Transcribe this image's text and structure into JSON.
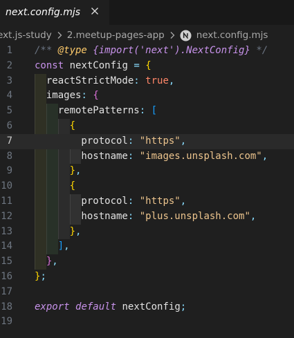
{
  "tab": {
    "filename": "next.config.mjs",
    "close_icon": "close-icon"
  },
  "breadcrumb": {
    "items": [
      "ext.js-study",
      "2.meetup-pages-app",
      "next.config.mjs"
    ],
    "file_icon": "nextjs-logo-icon",
    "separator_icon": "chevron-right-icon"
  },
  "editor": {
    "active_line": 7,
    "lines": [
      {
        "n": "1",
        "tokens": [
          {
            "t": "/** ",
            "c": "t-cmt"
          },
          {
            "t": "@type",
            "c": "t-tag"
          },
          {
            "t": " {import('next').NextConfig}",
            "c": "t-type"
          },
          {
            "t": " */",
            "c": "t-cmt"
          }
        ]
      },
      {
        "n": "2",
        "tokens": [
          {
            "t": "const",
            "c": "t-kw"
          },
          {
            "t": " nextConfig ",
            "c": "t-var"
          },
          {
            "t": "=",
            "c": "t-punc"
          },
          {
            "t": " ",
            "c": "t-var"
          },
          {
            "t": "{",
            "c": "b1"
          }
        ]
      },
      {
        "n": "3",
        "tokens": [
          {
            "t": "  reactStrictMode",
            "c": "t-prop"
          },
          {
            "t": ":",
            "c": "t-punc"
          },
          {
            "t": " ",
            "c": "t-var"
          },
          {
            "t": "true",
            "c": "t-bool"
          },
          {
            "t": ",",
            "c": "t-punc"
          }
        ]
      },
      {
        "n": "4",
        "tokens": [
          {
            "t": "  images",
            "c": "t-prop"
          },
          {
            "t": ":",
            "c": "t-punc"
          },
          {
            "t": " ",
            "c": "t-var"
          },
          {
            "t": "{",
            "c": "b2"
          }
        ]
      },
      {
        "n": "5",
        "tokens": [
          {
            "t": "    remotePatterns",
            "c": "t-prop"
          },
          {
            "t": ":",
            "c": "t-punc"
          },
          {
            "t": " ",
            "c": "t-var"
          },
          {
            "t": "[",
            "c": "b3"
          }
        ]
      },
      {
        "n": "6",
        "tokens": [
          {
            "t": "      ",
            "c": "t-var"
          },
          {
            "t": "{",
            "c": "b1"
          }
        ]
      },
      {
        "n": "7",
        "tokens": [
          {
            "t": "        protocol",
            "c": "t-prop"
          },
          {
            "t": ":",
            "c": "t-punc"
          },
          {
            "t": " ",
            "c": "t-var"
          },
          {
            "t": "\"https\"",
            "c": "t-str"
          },
          {
            "t": ",",
            "c": "t-punc"
          }
        ]
      },
      {
        "n": "8",
        "tokens": [
          {
            "t": "        hostname",
            "c": "t-prop"
          },
          {
            "t": ":",
            "c": "t-punc"
          },
          {
            "t": " ",
            "c": "t-var"
          },
          {
            "t": "\"images.unsplash.com\"",
            "c": "t-str"
          },
          {
            "t": ",",
            "c": "t-punc"
          }
        ]
      },
      {
        "n": "9",
        "tokens": [
          {
            "t": "      ",
            "c": "t-var"
          },
          {
            "t": "}",
            "c": "b1"
          },
          {
            "t": ",",
            "c": "t-punc"
          }
        ]
      },
      {
        "n": "10",
        "tokens": [
          {
            "t": "      ",
            "c": "t-var"
          },
          {
            "t": "{",
            "c": "b1"
          }
        ]
      },
      {
        "n": "11",
        "tokens": [
          {
            "t": "        protocol",
            "c": "t-prop"
          },
          {
            "t": ":",
            "c": "t-punc"
          },
          {
            "t": " ",
            "c": "t-var"
          },
          {
            "t": "\"https\"",
            "c": "t-str"
          },
          {
            "t": ",",
            "c": "t-punc"
          }
        ]
      },
      {
        "n": "12",
        "tokens": [
          {
            "t": "        hostname",
            "c": "t-prop"
          },
          {
            "t": ":",
            "c": "t-punc"
          },
          {
            "t": " ",
            "c": "t-var"
          },
          {
            "t": "\"plus.unsplash.com\"",
            "c": "t-str"
          },
          {
            "t": ",",
            "c": "t-punc"
          }
        ]
      },
      {
        "n": "13",
        "tokens": [
          {
            "t": "      ",
            "c": "t-var"
          },
          {
            "t": "}",
            "c": "b1"
          },
          {
            "t": ",",
            "c": "t-punc"
          }
        ]
      },
      {
        "n": "14",
        "tokens": [
          {
            "t": "    ",
            "c": "t-var"
          },
          {
            "t": "]",
            "c": "b3"
          },
          {
            "t": ",",
            "c": "t-punc"
          }
        ]
      },
      {
        "n": "15",
        "tokens": [
          {
            "t": "  ",
            "c": "t-var"
          },
          {
            "t": "}",
            "c": "b2"
          },
          {
            "t": ",",
            "c": "t-punc"
          }
        ]
      },
      {
        "n": "16",
        "tokens": [
          {
            "t": "}",
            "c": "b1"
          },
          {
            "t": ";",
            "c": "t-punc"
          }
        ]
      },
      {
        "n": "17",
        "tokens": []
      },
      {
        "n": "18",
        "tokens": [
          {
            "t": "export",
            "c": "t-kwi"
          },
          {
            "t": " ",
            "c": "t-var"
          },
          {
            "t": "default",
            "c": "t-kwi"
          },
          {
            "t": " nextConfig",
            "c": "t-var"
          },
          {
            "t": ";",
            "c": "t-punc"
          }
        ]
      },
      {
        "n": "19",
        "tokens": []
      }
    ]
  },
  "colors": {
    "editor_bg": "#1f1f1f",
    "tab_bar_bg": "#181818",
    "active_line_bg": "#2a2a2a",
    "line_number": "#6e7681",
    "line_number_active": "#cccccc",
    "string": "#ecc48d",
    "keyword": "#c792ea",
    "boolean": "#ff8668",
    "bracket_level_1": "#ffd700",
    "bracket_level_2": "#da70d6",
    "bracket_level_3": "#179fff"
  }
}
